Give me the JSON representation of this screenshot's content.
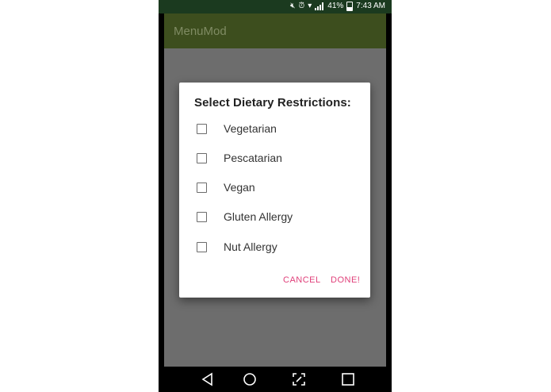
{
  "status_bar": {
    "battery": "41%",
    "time": "7:43 AM"
  },
  "app_bar": {
    "title": "MenuMod"
  },
  "dialog": {
    "title": "Select Dietary Restrictions:",
    "options": [
      {
        "label": "Vegetarian",
        "checked": false
      },
      {
        "label": "Pescatarian",
        "checked": false
      },
      {
        "label": "Vegan",
        "checked": false
      },
      {
        "label": "Gluten Allergy",
        "checked": false
      },
      {
        "label": "Nut Allergy",
        "checked": false
      }
    ],
    "cancel_label": "CANCEL",
    "done_label": "DONE!"
  },
  "fab": {
    "icon": "camera-icon"
  },
  "nav": {
    "icons": [
      "back-icon",
      "home-icon",
      "screenshot-icon",
      "recents-icon"
    ]
  },
  "colors": {
    "app_bar": "#3d4e1e",
    "status_bar": "#1b3a1f",
    "accent": "#e0407a",
    "fab": "#7a2449"
  }
}
